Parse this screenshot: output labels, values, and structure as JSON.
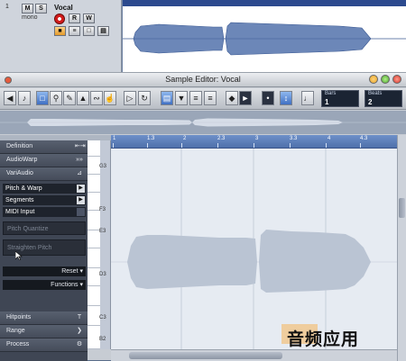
{
  "track": {
    "number": "1",
    "name": "Vocal",
    "mode": "mono",
    "buttons": [
      "M",
      "S",
      "R",
      "W"
    ]
  },
  "editor": {
    "title": "Sample Editor: Vocal",
    "counters": [
      {
        "label": "Bars",
        "value": "1"
      },
      {
        "label": "Beats",
        "value": "2"
      }
    ]
  },
  "inspector": {
    "tabs": [
      {
        "label": "Definition",
        "icon": "range-icon"
      },
      {
        "label": "AudioWarp",
        "icon": "forward-icon"
      },
      {
        "label": "VariAudio",
        "icon": "pitch-icon"
      }
    ],
    "subtabs": [
      {
        "label": "Pitch & Warp",
        "icon": "play-arrow-icon"
      },
      {
        "label": "Segments",
        "icon": "play-arrow-icon"
      },
      {
        "label": "MIDI Input",
        "icon": "box-icon"
      }
    ],
    "disabled_fields": [
      "Pitch Quantize",
      "Straighten Pitch"
    ],
    "reset_label": "Reset",
    "functions_label": "Functions",
    "bottom_tabs": [
      {
        "label": "Hitpoints",
        "icon": "t-icon"
      },
      {
        "label": "Range",
        "icon": "chevron-icon"
      },
      {
        "label": "Process",
        "icon": "gear-icon"
      }
    ]
  },
  "keyboard": {
    "notes": [
      "G3",
      "F3",
      "E3",
      "D3",
      "C3",
      "B2"
    ]
  },
  "ruler": {
    "ticks": [
      "1",
      "1.3",
      "2",
      "2.3",
      "3",
      "3.3",
      "4",
      "4.3"
    ]
  },
  "watermark": "音频应用"
}
